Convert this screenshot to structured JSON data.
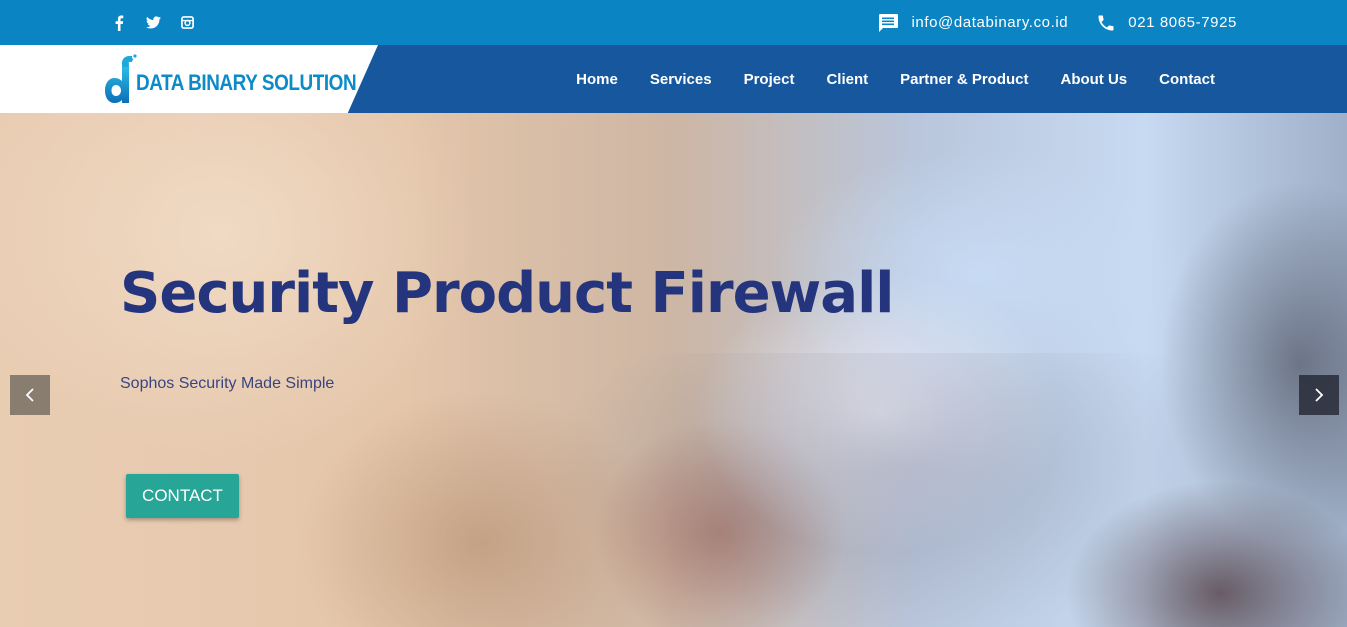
{
  "topbar": {
    "social": [
      {
        "name": "facebook",
        "glyph": "f"
      },
      {
        "name": "twitter",
        "glyph": "t"
      },
      {
        "name": "instagram",
        "glyph": "i"
      }
    ],
    "email": "info@databinary.co.id",
    "phone": "021 8065-7925",
    "email_icon": "message-icon",
    "phone_icon": "phone-icon"
  },
  "navbar": {
    "logo_text": "DATA BINARY SOLUTION",
    "menu": [
      "Home",
      "Services",
      "Project",
      "Client",
      "Partner & Product",
      "About Us",
      "Contact"
    ]
  },
  "hero": {
    "title": "Security Product Firewall",
    "subtitle": "Sophos Security Made Simple",
    "cta_label": "CONTACT",
    "prev_icon": "chevron-left-icon",
    "next_icon": "chevron-right-icon"
  },
  "colors": {
    "topbar": "#0b84c4",
    "navbar": "#16579e",
    "title": "#24357e",
    "cta": "#27a597",
    "logo": "#0d8bc9"
  }
}
